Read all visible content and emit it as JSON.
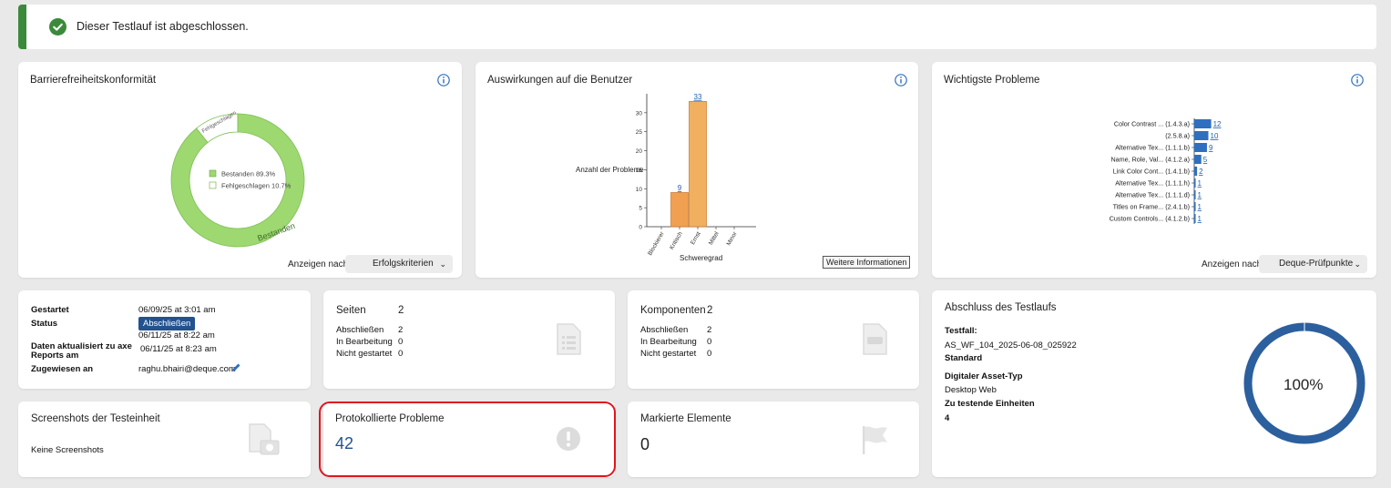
{
  "banner": {
    "message": "Dieser Testlauf ist abgeschlossen."
  },
  "conformance": {
    "title": "Barrierefreiheitskonformität",
    "donut_label_fail": "Fehlgeschlagen",
    "donut_label_pass": "Bestanden",
    "legend_pass": "Bestanden 89.3%",
    "legend_fail": "Fehlgeschlagen 10.7%",
    "pass_percent": 89.3,
    "fail_percent": 10.7,
    "view_by_label": "Anzeigen nach",
    "view_by_value": "Erfolgskriterien",
    "colors": {
      "pass": "#9ed870",
      "fail": "#ffffff",
      "border": "#7dbf55"
    }
  },
  "impact": {
    "title": "Auswirkungen auf die Benutzer",
    "more_button": "Weitere Informationen",
    "chart_data": {
      "type": "bar",
      "categories": [
        "Blockierer",
        "Kritisch",
        "Ernst",
        "Mittel",
        "Minor"
      ],
      "values": [
        0,
        9,
        33,
        0,
        0
      ],
      "ylabel": "Anzahl der Probleme",
      "xlabel": "Schweregrad",
      "yticks": [
        0,
        5,
        10,
        15,
        20,
        25,
        30
      ],
      "ylim": [
        0,
        35
      ],
      "data_labels": [
        "",
        "9",
        "33",
        "",
        ""
      ],
      "colors": [
        "#f0a050",
        "#f0a050",
        "#f0b060",
        "#f0a050",
        "#f0a050"
      ]
    }
  },
  "top_issues": {
    "title": "Wichtigste Probleme",
    "view_by_label": "Anzeigen nach",
    "view_by_value": "Deque-Prüfpunkte",
    "chart_data": {
      "type": "bar",
      "orientation": "horizontal",
      "categories": [
        "Color Contrast ... (1.4.3.a)",
        "(2.5.8.a)",
        "Alternative Tex... (1.1.1.b)",
        "Name, Role, Val... (4.1.2.a)",
        "Link Color Cont... (1.4.1.b)",
        "Alternative Tex... (1.1.1.h)",
        "Alternative Tex... (1.1.1.d)",
        "Titles on Frame... (2.4.1.b)",
        "Custom Controls... (4.1.2.b)"
      ],
      "values": [
        12,
        10,
        9,
        5,
        2,
        1,
        1,
        1,
        1
      ],
      "labels": [
        "12",
        "10",
        "9",
        "5",
        "2",
        "1",
        "1",
        "1",
        "1"
      ],
      "color": "#2f6fbf"
    }
  },
  "details": {
    "started_label": "Gestartet",
    "started_value": "06/09/25 at 3:01 am",
    "status_label": "Status",
    "status_badge": "Abschließen",
    "status_date": "06/11/25 at 8:22 am",
    "updated_label_1": "Daten aktualisiert zu axe",
    "updated_label_2": "Reports am",
    "updated_value": "06/11/25 at 8:23 am",
    "assigned_label": "Zugewiesen an",
    "assigned_value": "raghu.bhairi@deque.com"
  },
  "pages": {
    "title": "Seiten",
    "count": "2",
    "rows": [
      {
        "label": "Abschließen",
        "value": "2"
      },
      {
        "label": "In Bearbeitung",
        "value": "0"
      },
      {
        "label": "Nicht gestartet",
        "value": "0"
      }
    ]
  },
  "components": {
    "title": "Komponenten",
    "count": "2",
    "rows": [
      {
        "label": "Abschließen",
        "value": "2"
      },
      {
        "label": "In Bearbeitung",
        "value": "0"
      },
      {
        "label": "Nicht gestartet",
        "value": "0"
      }
    ]
  },
  "completion": {
    "title": "Abschluss des Testlaufs",
    "testcase_label": "Testfall:",
    "testcase_value": "AS_WF_104_2025-06-08_025922",
    "testcase_standard": "Standard",
    "asset_type_label": "Digitaler Asset-Typ",
    "asset_type_value": "Desktop Web",
    "units_label": "Zu testende Einheiten",
    "units_value": "4",
    "percent_text": "100%",
    "percent": 100,
    "ring_color": "#2c5f9e"
  },
  "screenshots": {
    "title": "Screenshots der Testeinheit",
    "empty": "Keine Screenshots"
  },
  "logged_issues": {
    "title": "Protokollierte Probleme",
    "count": "42",
    "count_color": "#23528f",
    "highlight_color": "#e0161e"
  },
  "flagged": {
    "title": "Markierte Elemente",
    "count": "0"
  }
}
